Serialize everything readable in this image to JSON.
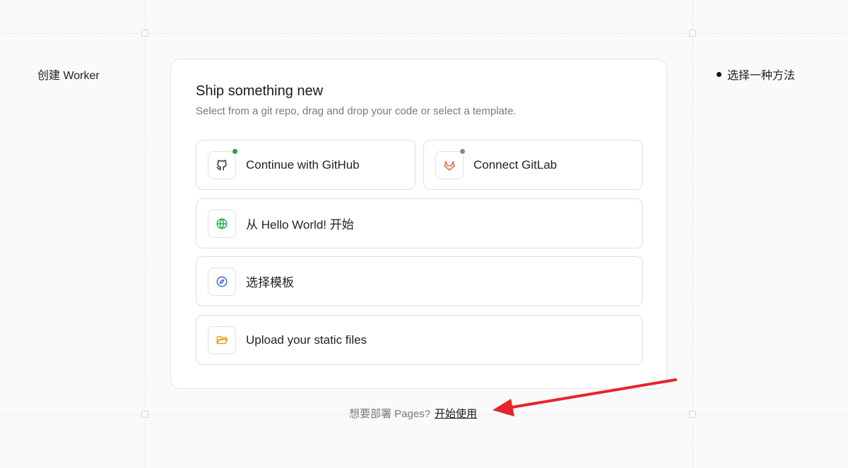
{
  "page": {
    "left_title": "创建 Worker",
    "right_note": "选择一种方法"
  },
  "card": {
    "title": "Ship something new",
    "subtitle": "Select from a git repo, drag and drop your code or select a template."
  },
  "options": {
    "github": {
      "label": "Continue with GitHub",
      "icon": "github-icon",
      "status_color": "#22a34a"
    },
    "gitlab": {
      "label": "Connect GitLab",
      "icon": "gitlab-icon",
      "status_color": "#8a8a8a"
    },
    "hello_world": {
      "label": "从 Hello World! 开始",
      "icon": "globe-icon",
      "icon_color": "#2ea54f"
    },
    "template": {
      "label": "选择模板",
      "icon": "compass-icon",
      "icon_color": "#3b6fd8"
    },
    "upload": {
      "label": "Upload your static files",
      "icon": "folder-icon",
      "icon_color": "#e0a51a"
    }
  },
  "footer": {
    "prompt": "想要部署 Pages?",
    "link": "开始使用"
  },
  "annotation": {
    "arrow_color": "#e5252a"
  }
}
